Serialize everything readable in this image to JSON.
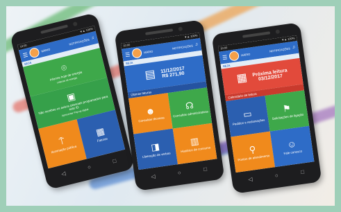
{
  "colors": {
    "blue": "#2e6cc7",
    "green": "#3ea84a",
    "orange": "#f08a1c",
    "red": "#e24a3b",
    "darkblue": "#2b5fb0"
  },
  "phone1": {
    "status_left": "10:00",
    "status_right": "▼▲ 100%",
    "user": "MÁRIO",
    "right_label": "NOTIFICAÇÕES",
    "stripe": "SEJA",
    "tile_top": "Informe hoje de energia",
    "tile_top_sub": "Leituras de energia",
    "tile_mid": "Não recebeu os avisos pessoais programados para este ID",
    "tile_mid_sub": "Apresentar Pop-up digital",
    "tile_bl": "Iluminação pública",
    "tile_br": "Faturas"
  },
  "phone2": {
    "status_left": "10:00",
    "status_right": "▼▲ 100%",
    "user": "MÁRIO",
    "right_label": "NOTIFICAÇÕES",
    "stripe": "SEJA",
    "date": "11/12/2017",
    "amount": "R$ 271,90",
    "bar_label": "Últimas faturas",
    "tile_tl": "Consultas técnicas",
    "tile_tr": "Consultas administrativas",
    "tile_bl": "Liberação de verbas",
    "tile_br": "Histórico de consumo"
  },
  "phone3": {
    "status_left": "10:00",
    "status_right": "▼▲ 100%",
    "user": "MÁRIO",
    "right_label": "NOTIFICAÇÕES",
    "stripe": "SEJA",
    "date_title": "Próxima leitura",
    "date": "03/12/2017",
    "bar_label": "Calendário de leitura",
    "tile_tl": "Pedidos e reclamações",
    "tile_tr": "Solicitações de ligação",
    "tile_bl": "Pontos de atendimento",
    "tile_br": "Fale conosco"
  }
}
